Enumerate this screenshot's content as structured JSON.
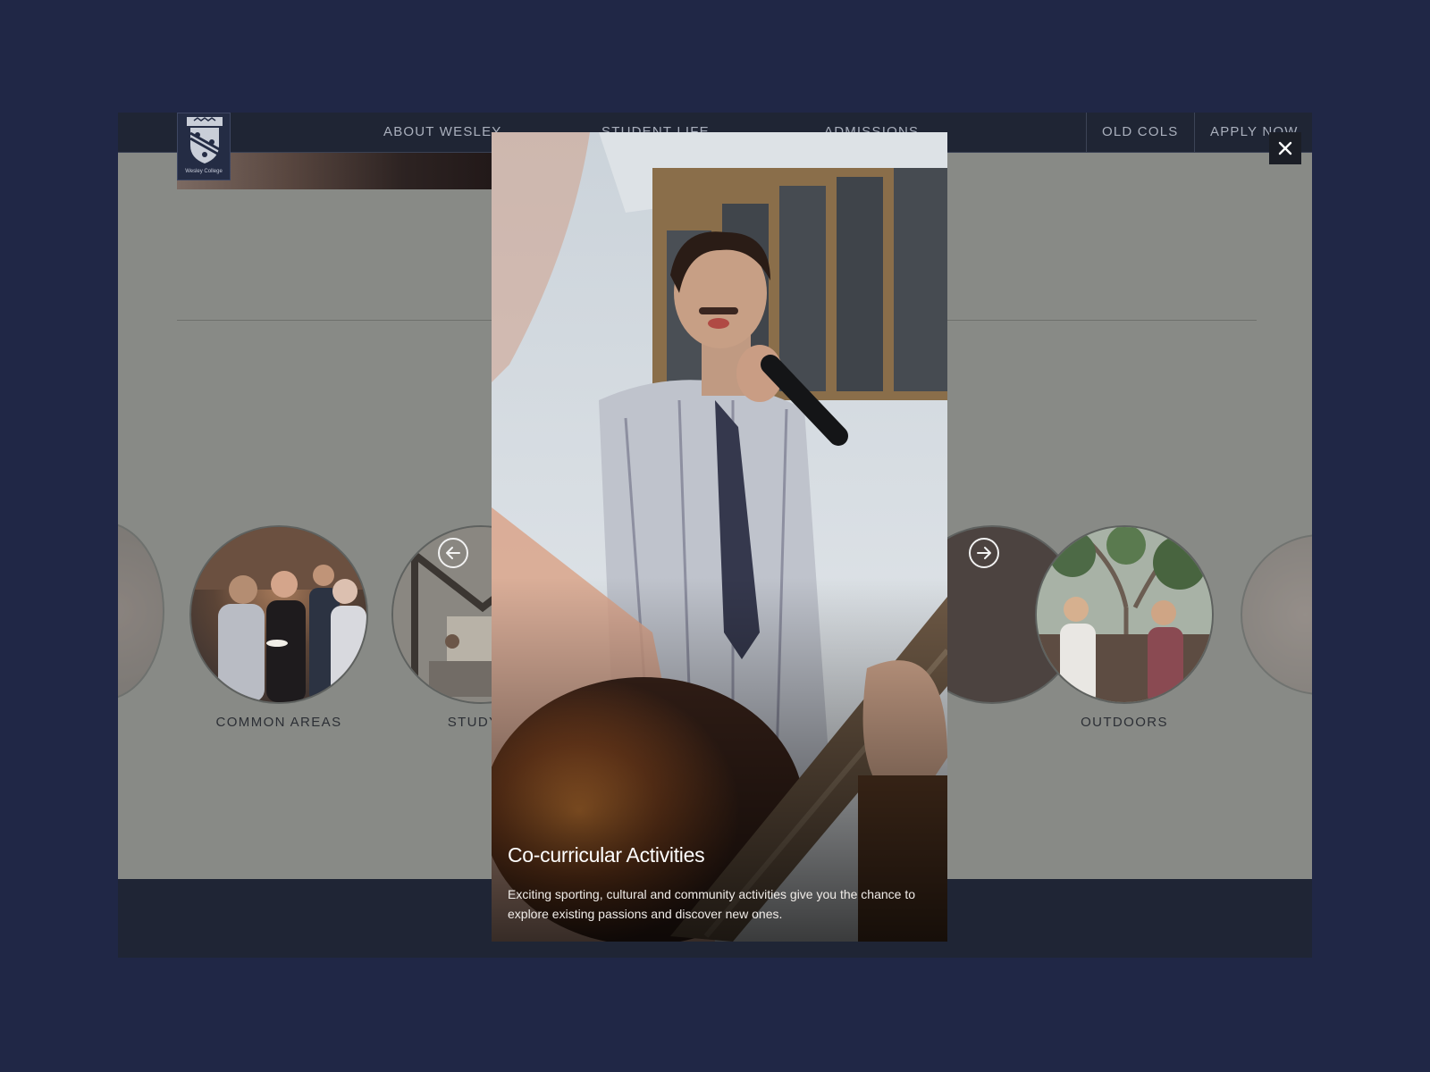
{
  "nav": {
    "logo_text": "Wesley College",
    "items": [
      "ABOUT WESLEY",
      "STUDENT LIFE",
      "ADMISSIONS"
    ],
    "right_items": [
      "OLD COLS",
      "APPLY NOW"
    ]
  },
  "carousel": {
    "items": [
      {
        "label": "COMMON AREAS"
      },
      {
        "label": "STUDY S"
      },
      {
        "label": "OUTDOORS"
      }
    ],
    "prev_icon": "arrow-left-icon",
    "next_icon": "arrow-right-icon"
  },
  "modal": {
    "title": "Co-curricular Activities",
    "description": "Exciting sporting, cultural and community activities give you the chance to explore existing passions and discover new ones.",
    "close_icon": "close-icon"
  },
  "colors": {
    "page_bg": "#202746",
    "nav_bg": "#1f2534",
    "overlay_content": "#888a86",
    "footer_bg": "#1f2535"
  }
}
